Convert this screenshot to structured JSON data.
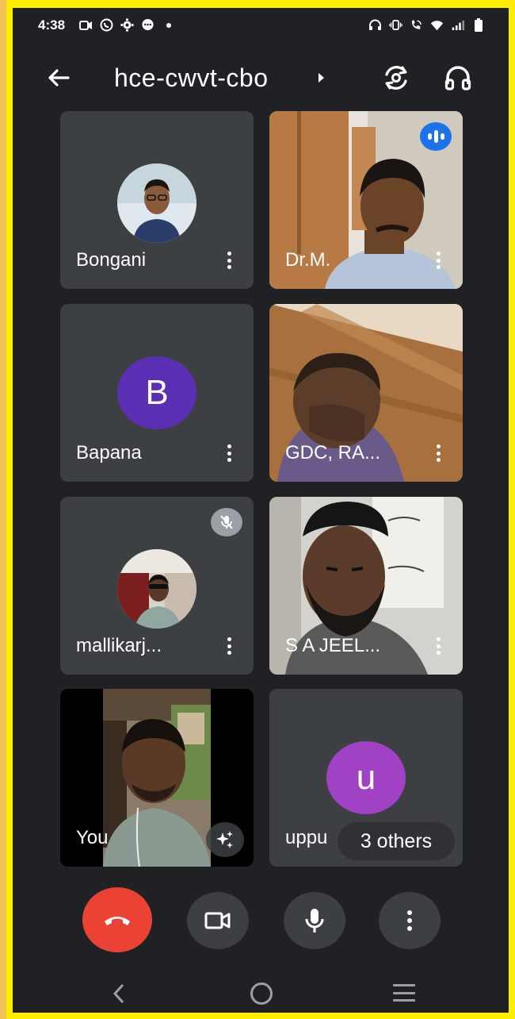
{
  "status_bar": {
    "time": "4:38",
    "left_icons": [
      "video-call-icon",
      "whatsapp-icon",
      "settings-icon",
      "messages-icon",
      "dot-icon"
    ],
    "right_icons": [
      "headset-icon",
      "vibrate-icon",
      "wifi-calling-icon",
      "wifi-icon",
      "signal-icon",
      "battery-icon"
    ]
  },
  "top_bar": {
    "back_icon": "arrow-back-icon",
    "meeting_code": "hce-cwvt-cbo",
    "switch_camera_icon": "switch-camera-icon",
    "audio_icon": "headphones-icon"
  },
  "participants": [
    {
      "name": "Bongani",
      "type": "photo-avatar"
    },
    {
      "name": "Dr.M.",
      "type": "video",
      "speaking": true
    },
    {
      "name": "Bapana",
      "type": "letter-avatar",
      "letter": "B",
      "color": "#5b2fb3"
    },
    {
      "name": "GDC, RA...",
      "type": "video"
    },
    {
      "name": "mallikarj...",
      "type": "photo-avatar",
      "muted": true
    },
    {
      "name": "S A JEEL...",
      "type": "video"
    },
    {
      "name": "You",
      "type": "self-video"
    },
    {
      "name": "uppu",
      "type": "letter-avatar",
      "letter": "u",
      "color": "#a142c4"
    }
  ],
  "others_pill": "3 others",
  "controls": [
    "end-call-button",
    "camera-button",
    "mic-button",
    "more-options-button"
  ],
  "colors": {
    "background": "#202124",
    "tile": "#3c4043",
    "end_call": "#ea4335",
    "speaking": "#1a73e8",
    "frame": "#ffee00"
  }
}
